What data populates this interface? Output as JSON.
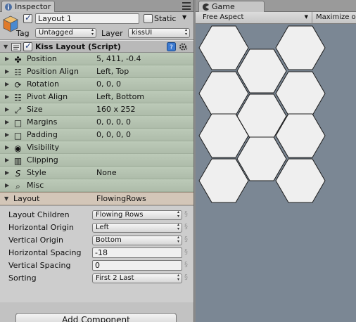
{
  "inspector": {
    "tab_label": "Inspector",
    "object": {
      "active": true,
      "name": "Layout 1",
      "static_label": "Static",
      "static_checked": false,
      "tag_label": "Tag",
      "tag_value": "Untagged",
      "layer_label": "Layer",
      "layer_value": "kissUI"
    },
    "component": {
      "enabled": true,
      "title": "Kiss Layout (Script)",
      "properties": [
        {
          "label": "Position",
          "value": "5, 411, -0.4",
          "icon": "move-arrows-icon"
        },
        {
          "label": "Position Align",
          "value": "Left, Top",
          "icon": "align-icon"
        },
        {
          "label": "Rotation",
          "value": "0, 0, 0",
          "icon": "rotate-icon"
        },
        {
          "label": "Pivot Align",
          "value": "Left, Bottom",
          "icon": "pivot-align-icon"
        },
        {
          "label": "Size",
          "value": "160 x 252",
          "icon": "resize-icon"
        },
        {
          "label": "Margins",
          "value": "0, 0, 0, 0",
          "icon": "square-icon"
        },
        {
          "label": "Padding",
          "value": "0, 0, 0, 0",
          "icon": "square-icon"
        },
        {
          "label": "Visibility",
          "value": "",
          "icon": "eye-icon"
        },
        {
          "label": "Clipping",
          "value": "",
          "icon": "clip-icon"
        },
        {
          "label": "Style",
          "value": "None",
          "icon": "style-s-icon"
        },
        {
          "label": "Misc",
          "value": "",
          "icon": "misc-lens-icon"
        }
      ],
      "layout": {
        "label": "Layout",
        "value": "FlowingRows",
        "fields": [
          {
            "label": "Layout Children",
            "type": "dropdown",
            "value": "Flowing Rows"
          },
          {
            "label": "Horizontal Origin",
            "type": "dropdown",
            "value": "Left"
          },
          {
            "label": "Vertical Origin",
            "type": "dropdown",
            "value": "Bottom"
          },
          {
            "label": "Horizontal Spacing",
            "type": "text",
            "value": "-18"
          },
          {
            "label": "Vertical Spacing",
            "type": "text",
            "value": "0"
          },
          {
            "label": "Sorting",
            "type": "dropdown",
            "value": "First 2 Last"
          }
        ]
      }
    },
    "add_component_label": "Add Component"
  },
  "game": {
    "tab_label": "Game",
    "aspect": "Free Aspect",
    "maximize": "Maximize o",
    "hex_fill": "#efefef",
    "hex_stroke": "#1c1c1c",
    "background": "#7b8794"
  },
  "colors": {
    "component_props_tint": "#b4c2b0",
    "layout_section_tint": "#d3c6b8",
    "panel_bg": "#c2c2c2"
  }
}
